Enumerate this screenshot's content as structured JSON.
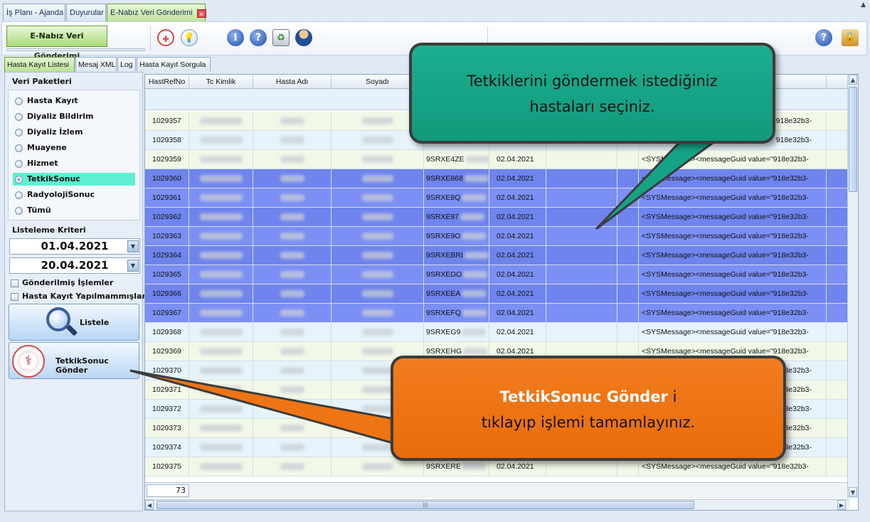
{
  "top_tabs": [
    {
      "label": "İş Planı - Ajanda"
    },
    {
      "label": "Duyurular"
    },
    {
      "label": "E-Nabız Veri Gönderimi"
    }
  ],
  "toolbar": {
    "module_label": "E-Nabız Veri Gönderimi"
  },
  "sub_tabs": [
    {
      "label": "Hasta Kayıt Listesi"
    },
    {
      "label": "Mesaj XML"
    },
    {
      "label": "Log"
    },
    {
      "label": "Hasta Kayıt Sorgula"
    }
  ],
  "left": {
    "packets_title": "Veri Paketleri",
    "packets": [
      {
        "label": "Hasta Kayıt"
      },
      {
        "label": "Diyaliz Bildirim"
      },
      {
        "label": "Diyaliz İzlem"
      },
      {
        "label": "Muayene"
      },
      {
        "label": "Hizmet"
      },
      {
        "label": "TetkikSonuc"
      },
      {
        "label": "RadyolojiSonuc"
      },
      {
        "label": "Tümü"
      }
    ],
    "selected_packet": "TetkikSonuc",
    "criteria_title": "Listeleme Kriteri",
    "date_from": "01.04.2021",
    "date_to": "20.04.2021",
    "check_sent": "Gönderilmiş İşlemler",
    "check_unregistered": "Hasta Kayıt Yapılmammışlar",
    "list_button": "Listele",
    "send_button": "TetkikSonuc Gönder"
  },
  "grid": {
    "columns": [
      "HastRefNo",
      "Tc Kimlik",
      "Hasta Adı",
      "Soyadı"
    ],
    "rows": [
      {
        "ref": "1029357",
        "code": "",
        "date": "",
        "msg": "918e32b3-"
      },
      {
        "ref": "1029358",
        "code": "",
        "date": "",
        "msg": "918e32b3-"
      },
      {
        "ref": "1029359",
        "code": "9SRXE4ZE",
        "date": "02.04.2021",
        "msg": "<SYSMessage><messageGuid value=\"918e32b3-"
      },
      {
        "ref": "1029360",
        "code": "9SRXE868",
        "date": "02.04.2021",
        "msg": "<SYSMessage><messageGuid value=\"918e32b3-"
      },
      {
        "ref": "1029361",
        "code": "9SRXE8Q",
        "date": "02.04.2021",
        "msg": "<SYSMessage><messageGuid value=\"918e32b3-"
      },
      {
        "ref": "1029362",
        "code": "9SRXE97",
        "date": "02.04.2021",
        "msg": "<SYSMessage><messageGuid value=\"918e32b3-"
      },
      {
        "ref": "1029363",
        "code": "9SRXE9O",
        "date": "02.04.2021",
        "msg": "<SYSMessage><messageGuid value=\"918e32b3-"
      },
      {
        "ref": "1029364",
        "code": "9SRXEBRI",
        "date": "02.04.2021",
        "msg": "<SYSMessage><messageGuid value=\"918e32b3-"
      },
      {
        "ref": "1029365",
        "code": "9SRXEDO",
        "date": "02.04.2021",
        "msg": "<SYSMessage><messageGuid value=\"918e32b3-"
      },
      {
        "ref": "1029366",
        "code": "9SRXEEA",
        "date": "02.04.2021",
        "msg": "<SYSMessage><messageGuid value=\"918e32b3-"
      },
      {
        "ref": "1029367",
        "code": "9SRXEFQ",
        "date": "02.04.2021",
        "msg": "<SYSMessage><messageGuid value=\"918e32b3-"
      },
      {
        "ref": "1029368",
        "code": "9SRXEG9",
        "date": "02.04.2021",
        "msg": "<SYSMessage><messageGuid value=\"918e32b3-"
      },
      {
        "ref": "1029369",
        "code": "9SRXEHG",
        "date": "02.04.2021",
        "msg": "<SYSMessage><messageGuid value=\"918e32b3-"
      },
      {
        "ref": "1029370",
        "code": "",
        "date": "",
        "msg": "918e32b3-"
      },
      {
        "ref": "1029371",
        "code": "",
        "date": "",
        "msg": "918e32b3-"
      },
      {
        "ref": "1029372",
        "code": "",
        "date": "",
        "msg": "918e32b3-"
      },
      {
        "ref": "1029373",
        "code": "",
        "date": "",
        "msg": "918e32b3-"
      },
      {
        "ref": "1029374",
        "code": "",
        "date": "",
        "msg": "918e32b3-"
      },
      {
        "ref": "1029375",
        "code": "9SRXERE",
        "date": "02.04.2021",
        "msg": "<SYSMessage><messageGuid value=\"918e32b3-"
      }
    ],
    "selected_rows": [
      "1029360",
      "1029361",
      "1029362",
      "1029363",
      "1029364",
      "1029365",
      "1029366",
      "1029367"
    ],
    "row_count": "73"
  },
  "callouts": {
    "select_line1": "Tetkiklerini göndermek istediğiniz",
    "select_line2": "hastaları seçiniz.",
    "send_bold": "TetkikSonuc Gönder",
    "send_suffix": " i",
    "send_line2": "tıklayıp işlemi tamamlayınız."
  },
  "colors": {
    "selected_row": "#7c8ff4",
    "green_callout": "#15a386",
    "orange_callout": "#ee7514",
    "selected_radio": "#5ff0d4"
  }
}
